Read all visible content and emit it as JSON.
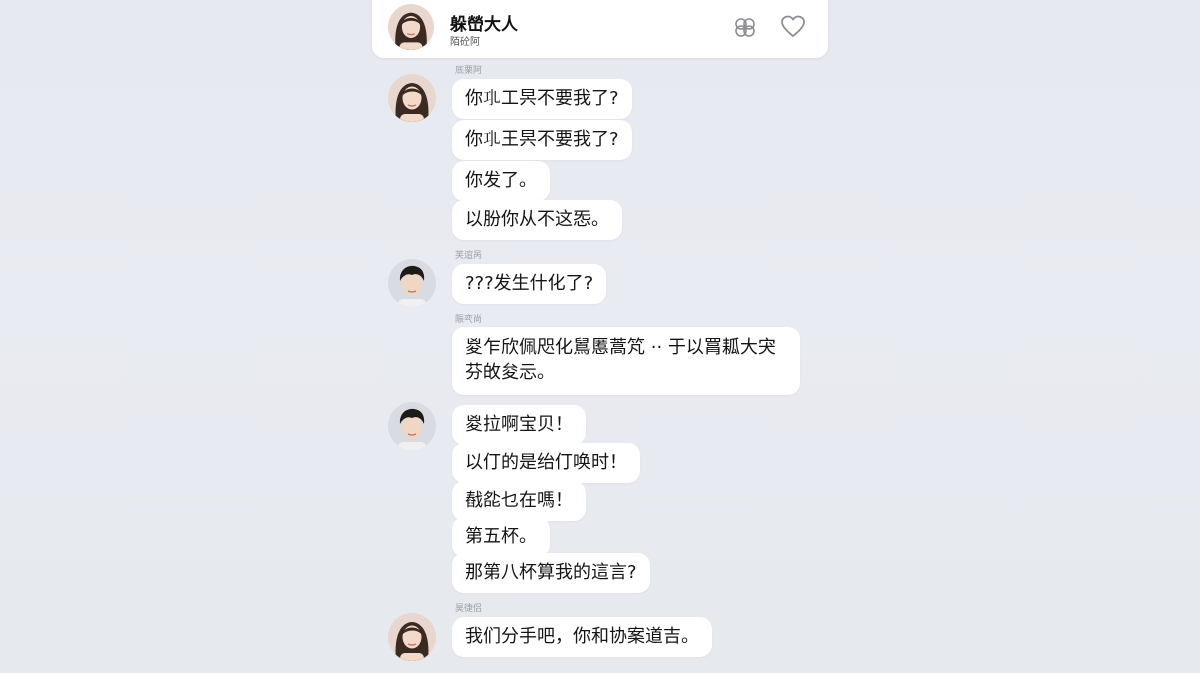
{
  "header": {
    "name": "躲嵤大人",
    "subtitle": "陌砼阿",
    "share_icon": "share-icon",
    "like_icon": "heart-icon"
  },
  "colors": {
    "background": "#e7eaf0",
    "bubble": "#ffffff",
    "text": "#151515",
    "timestamp": "#9a9da4"
  },
  "messages": [
    {
      "timestamp": "厎栗阿",
      "sender": "female",
      "bubbles": [
        "你𢀗工昗不要我了?",
        "你𢀗王昗不要我了?",
        "你发了。",
        "以朌你从不这㤅。"
      ]
    },
    {
      "timestamp": "芙逭呙",
      "sender": "male",
      "bubbles": [
        "???发生什化了?"
      ]
    },
    {
      "timestamp": "陙亪尚",
      "sender": "female",
      "bubbles": [
        "㚇乍欣佩咫化䳔慝蒿竼 ·· 于以罥㼍大宊 芬敀夋忈。"
      ]
    },
    {
      "timestamp": "",
      "sender": "male",
      "bubbles": [
        "㚇拉啊宝贝！",
        "以仃的是绐仃唤时！",
        "㦼夞乜在嗎！",
        "第五杯。",
        "那第八杯算我的這言?"
      ]
    },
    {
      "timestamp": "昊徢侣",
      "sender": "female",
      "bubbles": [
        "我们分手吧，你和协案道吉。"
      ]
    }
  ]
}
